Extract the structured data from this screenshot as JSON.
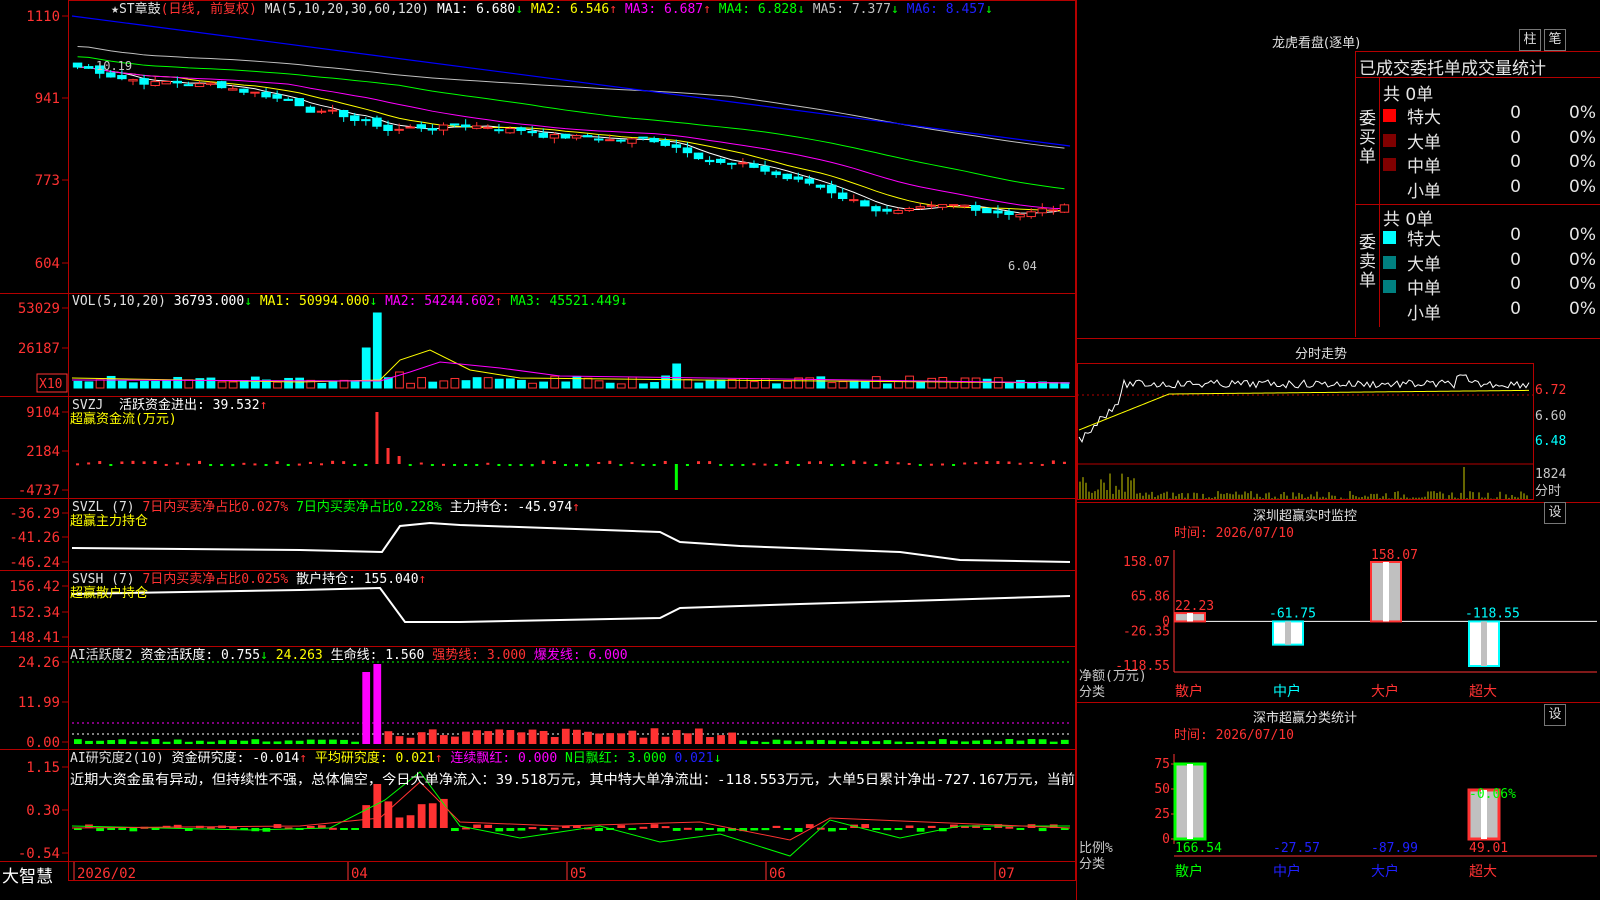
{
  "stock": {
    "name": "★ST章鼓",
    "period": "(日线, 前复权)"
  },
  "colors": {
    "up": "#ff3232",
    "down": "#00ffff",
    "ma1": "#ffffff",
    "ma2": "#ffff00",
    "ma3": "#ff00ff",
    "ma4": "#00ff00",
    "ma5": "#c0c0c0",
    "ma6": "#0000ff"
  },
  "main_indicator": {
    "label": "MA(5,10,20,30,60,120)",
    "ma1": "MA1: 6.680",
    "ma2": "MA2: 6.546",
    "ma3": "MA3: 6.687",
    "ma4": "MA4: 6.828",
    "ma5": "MA5: 7.377",
    "ma6": "MA6: 8.457",
    "high_label": "10.19",
    "low_label": "6.04"
  },
  "main_axis": [
    "1110",
    "941",
    "773",
    "604"
  ],
  "vol_panel": {
    "label": "VOL(5,10,20)",
    "v": "36793.000",
    "ma1": "MA1: 50994.000",
    "ma2": "MA2: 54244.602",
    "ma3": "MA3: 45521.449",
    "axis": [
      "53029",
      "26187"
    ],
    "unit": "X10"
  },
  "svzj_panel": {
    "label": "SVZJ",
    "active": "活跃资金进出: 39.532",
    "sub": "超赢资金流(万元)",
    "axis": [
      "9104",
      "2184",
      "-4737"
    ]
  },
  "svzl_panel": {
    "label": "SVZL (7)",
    "t1": "7日内买卖净占比0.027%",
    "t2": "7日内买卖净占比0.228%",
    "hold": "主力持仓: -45.974",
    "sub": "超赢主力持仓",
    "axis": [
      "-36.29",
      "-41.26",
      "-46.24"
    ]
  },
  "svsh_panel": {
    "label": "SVSH (7)",
    "t1": "7日内买卖净占比0.025%",
    "hold": "散户持仓: 155.040",
    "sub": "超赢散户持仓",
    "axis": [
      "156.42",
      "152.34",
      "148.41"
    ]
  },
  "ai_active_panel": {
    "label": "AI活跃度2",
    "v1": "资金活跃度: 0.755",
    "v2": "24.263",
    "v3": "生命线: 1.560",
    "v4": "强势线: 3.000",
    "v5": "爆发线: 6.000",
    "axis": [
      "24.26",
      "11.99",
      "0.00"
    ]
  },
  "ai_research_panel": {
    "label": "AI研究度2(10)",
    "v1": "资金研究度: -0.014",
    "v2": "平均研究度: 0.021",
    "v3": "连续飘红: 0.000",
    "v4": "N日飘红: 3.000",
    "v5": "0.021",
    "comment": "近期大资金虽有异动，但持续性不强，总体偏空，今日大单净流入：39.518万元，其中特大单净流出：-118.553万元，大单5日累计净出-727.167万元，当前",
    "axis": [
      "1.15",
      "0.30",
      "-0.54"
    ]
  },
  "date_axis": {
    "brand": "大智慧",
    "labels": [
      "2026/02",
      "04",
      "05",
      "06",
      "07"
    ]
  },
  "dragon_panel": {
    "title": "龙虎看盘(逐单)",
    "btn1": "柱",
    "btn2": "笔",
    "header": "已成交委托单成交量统计",
    "buy": {
      "label": "委买单",
      "total": "共 0单",
      "rows": [
        {
          "name": "特大",
          "count": "0",
          "pct": "0%"
        },
        {
          "name": "大单",
          "count": "0",
          "pct": "0%"
        },
        {
          "name": "中单",
          "count": "0",
          "pct": "0%"
        },
        {
          "name": "小单",
          "count": "0",
          "pct": "0%"
        }
      ]
    },
    "sell": {
      "label": "委卖单",
      "total": "共 0单",
      "rows": [
        {
          "name": "特大",
          "count": "0",
          "pct": "0%"
        },
        {
          "name": "大单",
          "count": "0",
          "pct": "0%"
        },
        {
          "name": "中单",
          "count": "0",
          "pct": "0%"
        },
        {
          "name": "小单",
          "count": "0",
          "pct": "0%"
        }
      ]
    }
  },
  "intraday_panel": {
    "title": "分时走势",
    "axis": [
      "6.72",
      "6.60",
      "6.48"
    ],
    "vol_axis": "1824",
    "unit": "分时"
  },
  "sz_monitor": {
    "title": "深圳超赢实时监控",
    "btn": "设",
    "time": "时间: 2026/07/10",
    "ylabel": "净额(万元)",
    "xlabel": "分类",
    "axis": [
      "158.07",
      "65.86",
      "0",
      "-26.35",
      "-118.55"
    ],
    "chart_data": {
      "type": "bar",
      "categories": [
        "散户",
        "中户",
        "大户",
        "超大"
      ],
      "values": [
        22.23,
        -61.75,
        158.07,
        -118.55
      ],
      "ylim": [
        -118.55,
        158.07
      ]
    }
  },
  "sz_stats": {
    "title": "深市超赢分类统计",
    "btn": "设",
    "time": "时间: 2026/07/10",
    "ylabel": "比例%",
    "xlabel": "分类",
    "axis": [
      "75",
      "50",
      "25",
      "0"
    ],
    "chart_data": {
      "type": "bar",
      "categories": [
        "散户",
        "中户",
        "大户",
        "超大"
      ],
      "values": [
        166.54,
        -27.57,
        -87.99,
        49.01
      ],
      "extra_label": "-0.06%",
      "ylim": [
        0,
        75
      ]
    }
  }
}
